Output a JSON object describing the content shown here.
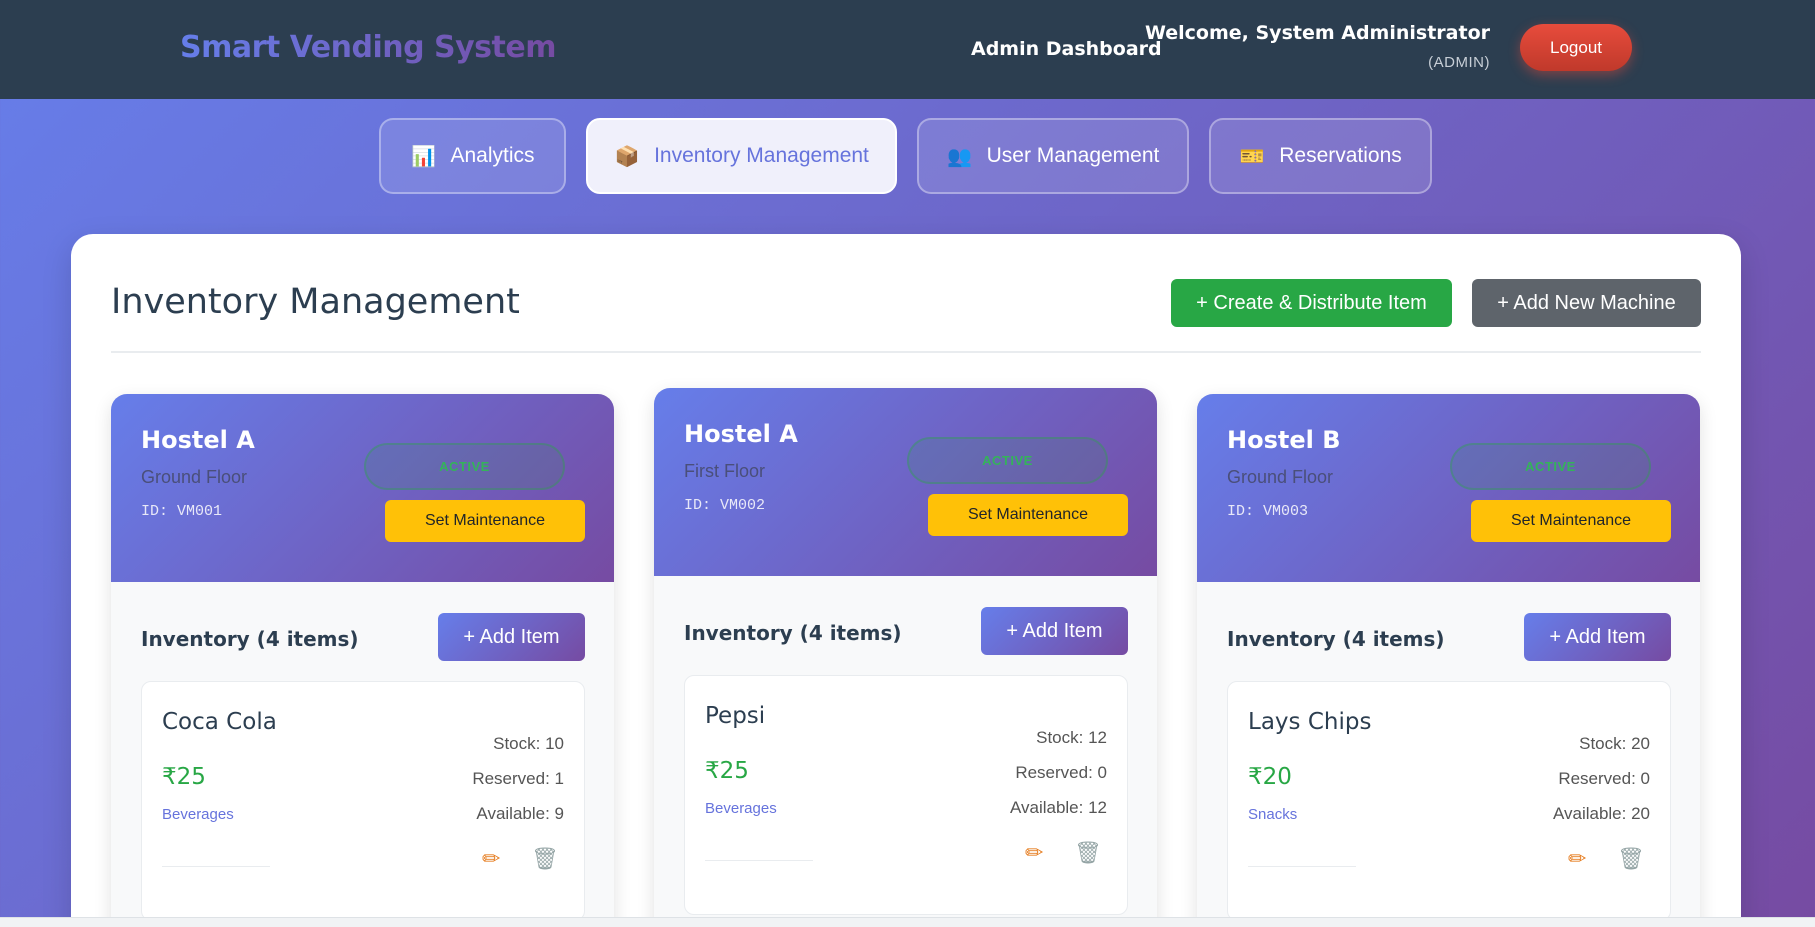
{
  "header": {
    "brand": "Smart Vending System",
    "dashboard": "Admin Dashboard",
    "welcome": "Welcome, System Administrator",
    "role": "(ADMIN)",
    "logout": "Logout"
  },
  "tabs": [
    {
      "label": "Analytics",
      "icon": "📊",
      "active": false
    },
    {
      "label": "Inventory Management",
      "icon": "📦",
      "active": true
    },
    {
      "label": "User Management",
      "icon": "👥",
      "active": false
    },
    {
      "label": "Reservations",
      "icon": "🎫",
      "active": false
    }
  ],
  "panel": {
    "title": "Inventory Management",
    "create_btn": "+ Create & Distribute Item",
    "add_machine_btn": "+ Add New Machine"
  },
  "machines": [
    {
      "name": "Hostel A",
      "floor": "Ground Floor",
      "id": "ID: VM001",
      "status": "ACTIVE",
      "maintenance": "Set Maintenance",
      "inventory_title": "Inventory (4 items)",
      "add_item": "+ Add Item",
      "item": {
        "name": "Coca Cola",
        "price": "₹25",
        "category": "Beverages",
        "stock": "Stock: 10",
        "reserved": "Reserved: 1",
        "available": "Available: 9"
      }
    },
    {
      "name": "Hostel A",
      "floor": "First Floor",
      "id": "ID: VM002",
      "status": "ACTIVE",
      "maintenance": "Set Maintenance",
      "inventory_title": "Inventory (4 items)",
      "add_item": "+ Add Item",
      "item": {
        "name": "Pepsi",
        "price": "₹25",
        "category": "Beverages",
        "stock": "Stock: 12",
        "reserved": "Reserved: 0",
        "available": "Available: 12"
      }
    },
    {
      "name": "Hostel B",
      "floor": "Ground Floor",
      "id": "ID: VM003",
      "status": "ACTIVE",
      "maintenance": "Set Maintenance",
      "inventory_title": "Inventory (4 items)",
      "add_item": "+ Add Item",
      "item": {
        "name": "Lays Chips",
        "price": "₹20",
        "category": "Snacks",
        "stock": "Stock: 20",
        "reserved": "Reserved: 0",
        "available": "Available: 20"
      }
    }
  ],
  "icons": {
    "edit": "✏",
    "delete": "🗑"
  }
}
